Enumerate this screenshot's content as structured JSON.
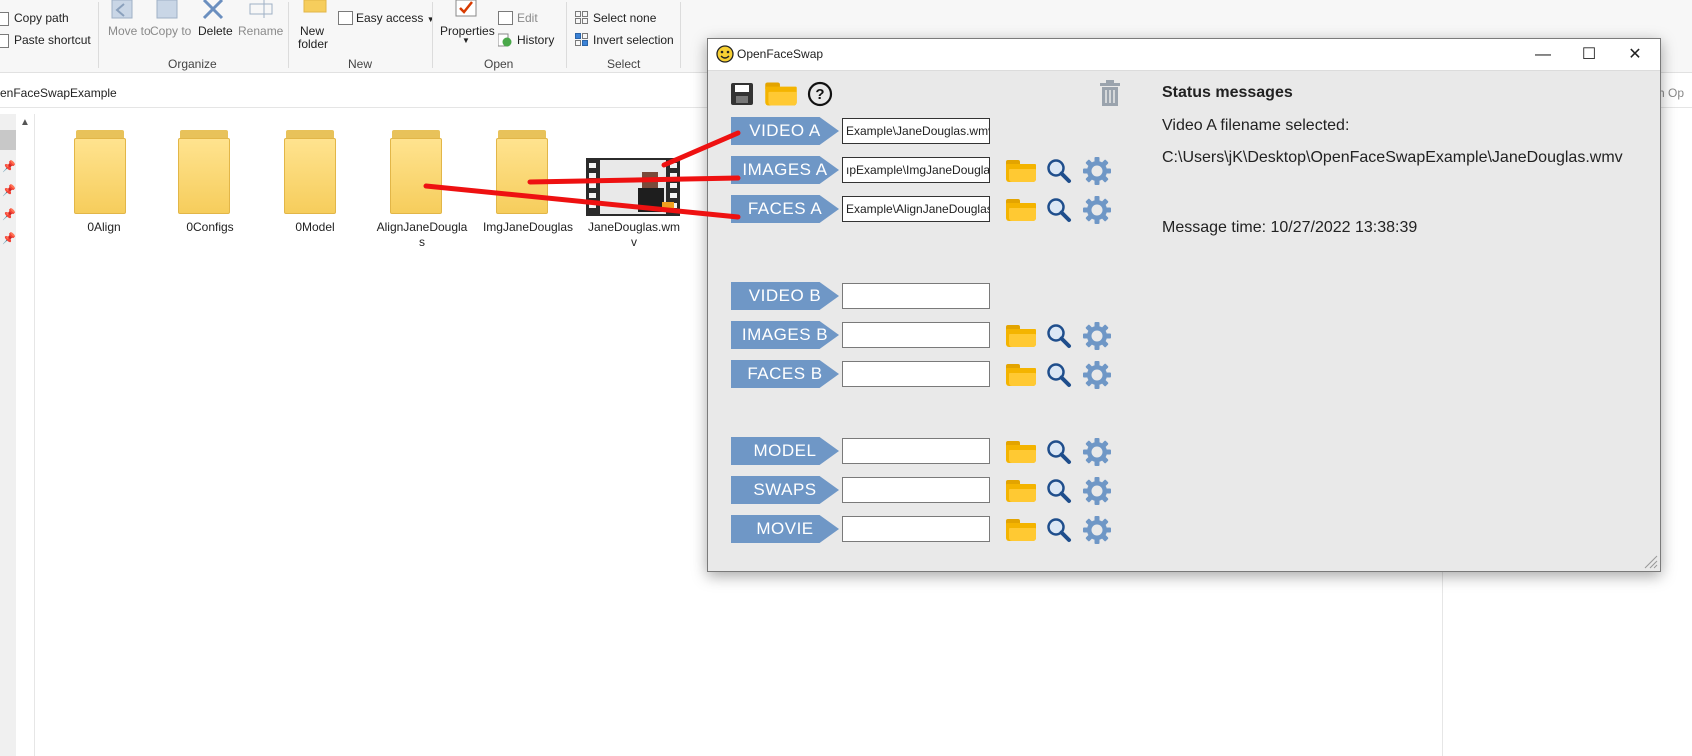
{
  "explorer": {
    "ribbon": {
      "copy_path": "Copy path",
      "paste_shortcut": "Paste shortcut",
      "move_to": "Move to",
      "copy_to": "Copy to",
      "delete": "Delete",
      "rename": "Rename",
      "new_folder_1": "New",
      "new_folder_2": "folder",
      "easy_access": "Easy access",
      "properties": "Properties",
      "edit": "Edit",
      "history": "History",
      "select_none": "Select none",
      "invert_selection": "Invert selection",
      "groups": {
        "organize": "Organize",
        "new": "New",
        "open": "Open",
        "select": "Select"
      }
    },
    "address": "enFaceSwapExample",
    "search_fragment": "ch Op",
    "files": [
      {
        "name": "0Align",
        "type": "folder"
      },
      {
        "name": "0Configs",
        "type": "folder"
      },
      {
        "name": "0Model",
        "type": "folder"
      },
      {
        "name": "AlignJaneDouglas",
        "type": "folder"
      },
      {
        "name": "ImgJaneDouglas",
        "type": "folder"
      },
      {
        "name": "JaneDouglas.wmv",
        "type": "video"
      }
    ]
  },
  "ofs": {
    "title": "OpenFaceSwap",
    "window_controls": {
      "minimize": "—",
      "maximize": "☐",
      "close": "✕"
    },
    "rows_a": [
      {
        "label": "VIDEO A",
        "value": "Example\\JaneDouglas.wmv",
        "has_tools": false
      },
      {
        "label": "IMAGES A",
        "value": "ıpExample\\ImgJaneDouglas",
        "has_tools": true
      },
      {
        "label": "FACES A",
        "value": "Example\\AlignJaneDouglas",
        "has_tools": true
      }
    ],
    "rows_b": [
      {
        "label": "VIDEO B",
        "value": "",
        "has_tools": false
      },
      {
        "label": "IMAGES B",
        "value": "",
        "has_tools": true
      },
      {
        "label": "FACES B",
        "value": "",
        "has_tools": true
      }
    ],
    "rows_c": [
      {
        "label": "MODEL",
        "value": "",
        "has_tools": true
      },
      {
        "label": "SWAPS",
        "value": "",
        "has_tools": true
      },
      {
        "label": "MOVIE",
        "value": "",
        "has_tools": true
      }
    ],
    "status": {
      "heading": "Status messages",
      "line1": "Video A filename selected:",
      "line2": "C:\\Users\\jK\\Desktop\\OpenFaceSwapExample\\JaneDouglas.wmv",
      "time": "Message time: 10/27/2022 13:38:39"
    }
  },
  "annotation_color": "#ee1111"
}
